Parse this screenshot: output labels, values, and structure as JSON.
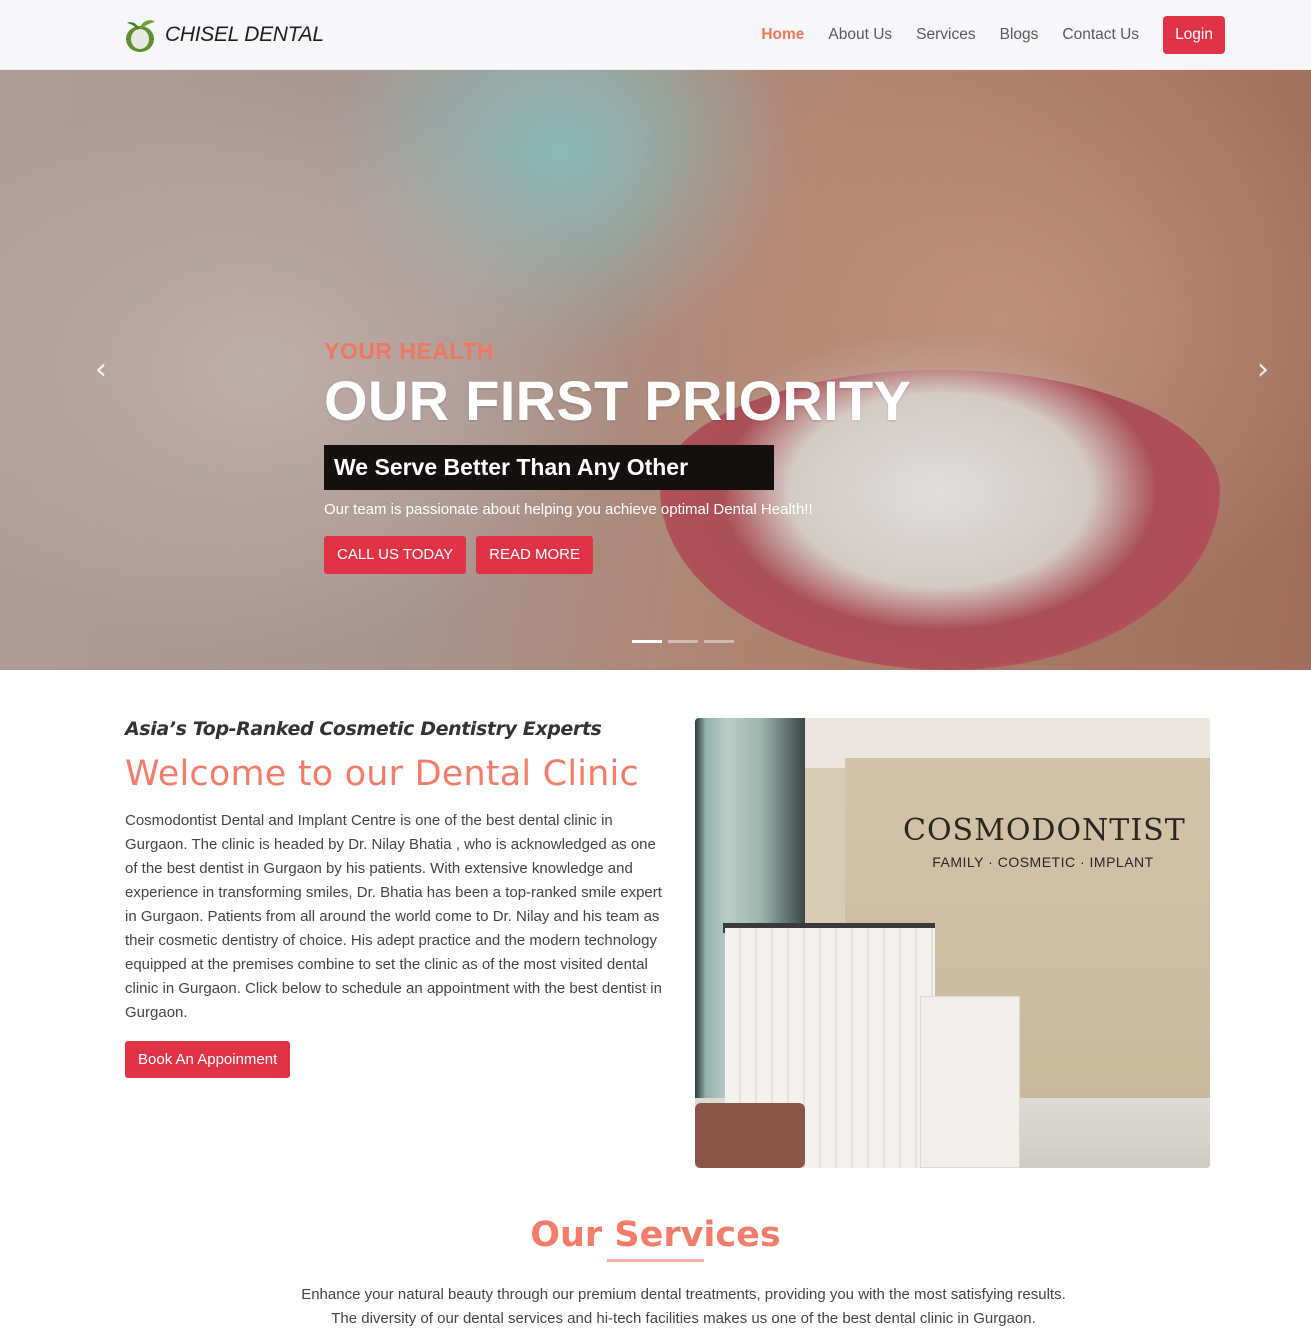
{
  "brand": {
    "name": "CHISEL DENTAL",
    "logo_icon": "tooth-leaf-logo-icon"
  },
  "nav": {
    "items": [
      {
        "label": "Home",
        "active": true
      },
      {
        "label": "About Us",
        "active": false
      },
      {
        "label": "Services",
        "active": false
      },
      {
        "label": "Blogs",
        "active": false
      },
      {
        "label": "Contact Us",
        "active": false
      }
    ],
    "login_label": "Login"
  },
  "hero": {
    "kicker": "YOUR HEALTH",
    "title": "OUR FIRST PRIORITY",
    "tagline": "We Serve Better Than Any Other",
    "text": "Our team is passionate about helping you achieve optimal Dental Health!!",
    "buttons": [
      "CALL US TODAY",
      "READ MORE"
    ],
    "prev_icon": "chevron-left-icon",
    "next_icon": "chevron-right-icon",
    "slides": 3,
    "active_slide": 1
  },
  "welcome": {
    "kicker": "Asia’s Top-Ranked Cosmetic Dentistry Experts",
    "title": "Welcome to our Dental Clinic",
    "body": "Cosmodontist Dental and Implant Centre is one of the best dental clinic in Gurgaon. The clinic is headed by Dr. Nilay Bhatia , who is acknowledged as one of the best dentist in Gurgaon by his patients. With extensive knowledge and experience in transforming smiles, Dr. Bhatia has been a top-ranked smile expert in Gurgaon. Patients from all around the world come to Dr. Nilay and his team as their cosmetic dentistry of choice. His adept practice and the modern technology equipped at the premises combine to set the clinic as of the most visited dental clinic in Gurgaon. Click below to schedule an appointment with the best dentist in Gurgaon.",
    "button": "Book An Appoinment",
    "image_sign_main": "COSMODONTIST",
    "image_sign_sub": "FAMILY · COSMETIC · IMPLANT"
  },
  "services": {
    "title": "Our Services",
    "text": "Enhance your natural beauty through our premium dental treatments, providing you with the most satisfying results. The diversity of our dental services and hi-tech facilities makes us one of the best dental clinic in Gurgaon."
  },
  "colors": {
    "accent": "#e03346",
    "heading": "#f47c6a",
    "active_nav": "#ee7a5b"
  }
}
